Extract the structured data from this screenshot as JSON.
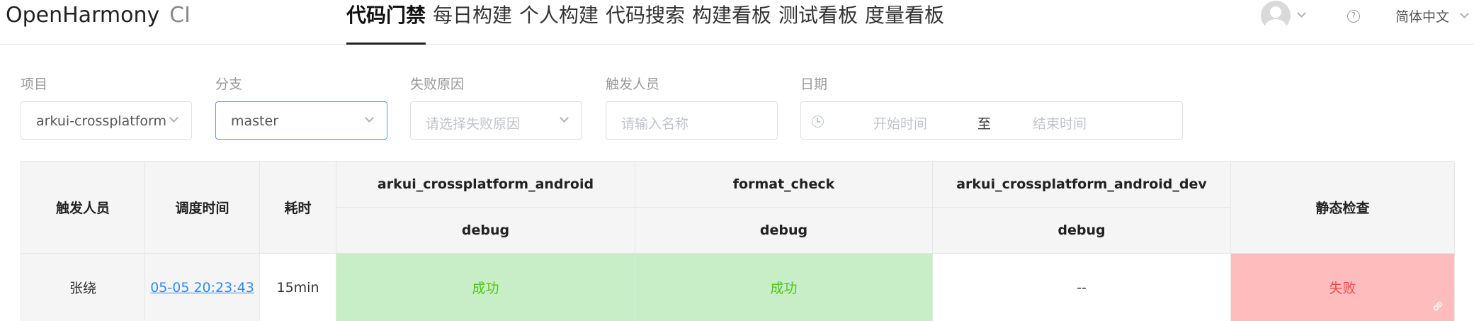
{
  "header": {
    "logo": "OpenHarmony",
    "logo_suffix": "CI",
    "nav": [
      {
        "label": "代码门禁",
        "active": true
      },
      {
        "label": "每日构建",
        "active": false
      },
      {
        "label": "个人构建",
        "active": false
      },
      {
        "label": "代码搜索",
        "active": false
      },
      {
        "label": "构建看板",
        "active": false
      },
      {
        "label": "测试看板",
        "active": false
      },
      {
        "label": "度量看板",
        "active": false
      }
    ],
    "help_symbol": "?",
    "language": "简体中文"
  },
  "filters": {
    "project": {
      "label": "项目",
      "value": "arkui-crossplatform"
    },
    "branch": {
      "label": "分支",
      "value": "master"
    },
    "failure_reason": {
      "label": "失败原因",
      "placeholder": "请选择失败原因"
    },
    "trigger_user": {
      "label": "触发人员",
      "placeholder": "请输入名称"
    },
    "date": {
      "label": "日期",
      "start_placeholder": "开始时间",
      "separator": "至",
      "end_placeholder": "结束时间"
    }
  },
  "table": {
    "headers": {
      "trigger": "触发人员",
      "schedule_time": "调度时间",
      "duration": "耗时",
      "col1": "arkui_crossplatform_android",
      "col1_sub": "debug",
      "col2": "format_check",
      "col2_sub": "debug",
      "col3": "arkui_crossplatform_android_dev",
      "col3_sub": "debug",
      "static_check": "静态检查"
    },
    "rows": [
      {
        "trigger": "张绕",
        "schedule_time": "05-05 20:23:43",
        "duration": "15min",
        "col1": "成功",
        "col2": "成功",
        "col3": "--",
        "static_check": "失败"
      }
    ]
  },
  "colors": {
    "success_bg": "#c7eec7",
    "success_text": "#52c41a",
    "fail_bg": "#ffbcbc",
    "fail_text": "#f04b4b",
    "link": "#2f8cf0",
    "focus_border": "#409eff"
  }
}
